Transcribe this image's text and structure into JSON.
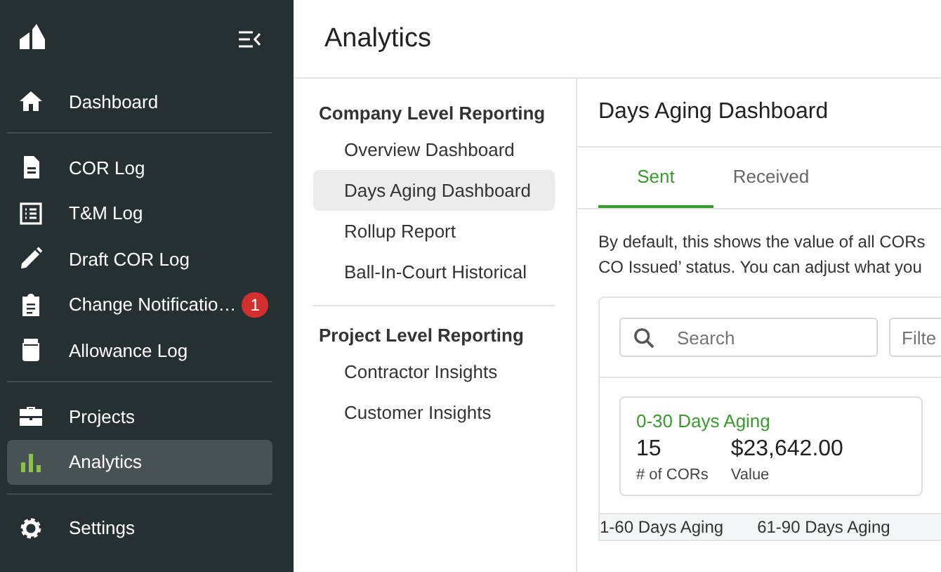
{
  "sidebar": {
    "items": [
      {
        "kind": "link",
        "label": "Dashboard",
        "selected": false
      },
      {
        "kind": "divider"
      },
      {
        "kind": "link",
        "label": "COR Log",
        "selected": false
      },
      {
        "kind": "link",
        "label": "T&M Log",
        "selected": false
      },
      {
        "kind": "link",
        "label": "Draft COR Log",
        "selected": false
      },
      {
        "kind": "link",
        "label": "Change Notificatio…",
        "badge": "1",
        "selected": false
      },
      {
        "kind": "link",
        "label": "Allowance Log",
        "selected": false
      },
      {
        "kind": "divider"
      },
      {
        "kind": "link",
        "label": "Projects",
        "selected": false
      },
      {
        "kind": "link",
        "label": "Analytics",
        "selected": true
      },
      {
        "kind": "divider"
      },
      {
        "kind": "link",
        "label": "Settings",
        "selected": false
      }
    ]
  },
  "header": {
    "title": "Analytics"
  },
  "reports": {
    "groups": [
      {
        "title": "Company Level Reporting",
        "items": [
          {
            "label": "Overview Dashboard",
            "selected": false
          },
          {
            "label": "Days Aging Dashboard",
            "selected": true
          },
          {
            "label": "Rollup Report",
            "selected": false
          },
          {
            "label": "Ball-In-Court Historical",
            "selected": false
          }
        ]
      },
      {
        "title": "Project Level Reporting",
        "items": [
          {
            "label": "Contractor Insights",
            "selected": false
          },
          {
            "label": "Customer Insights",
            "selected": false
          }
        ]
      }
    ]
  },
  "panel": {
    "title": "Days Aging Dashboard",
    "tabs": [
      {
        "label": "Sent",
        "selected": true
      },
      {
        "label": "Received",
        "selected": false
      }
    ],
    "description": [
      "By default, this shows the value of all CORs",
      "CO Issued’ status. You can adjust what you"
    ],
    "search": {
      "placeholder": "Search"
    },
    "filter": {
      "placeholder": "Filte"
    },
    "card": {
      "title": "0-30 Days Aging",
      "count": "15",
      "count_label": "# of CORs",
      "value": "$23,642.00",
      "value_label": "Value"
    },
    "next_tabs": [
      "1-60 Days Aging",
      "61-90 Days Aging"
    ]
  }
}
